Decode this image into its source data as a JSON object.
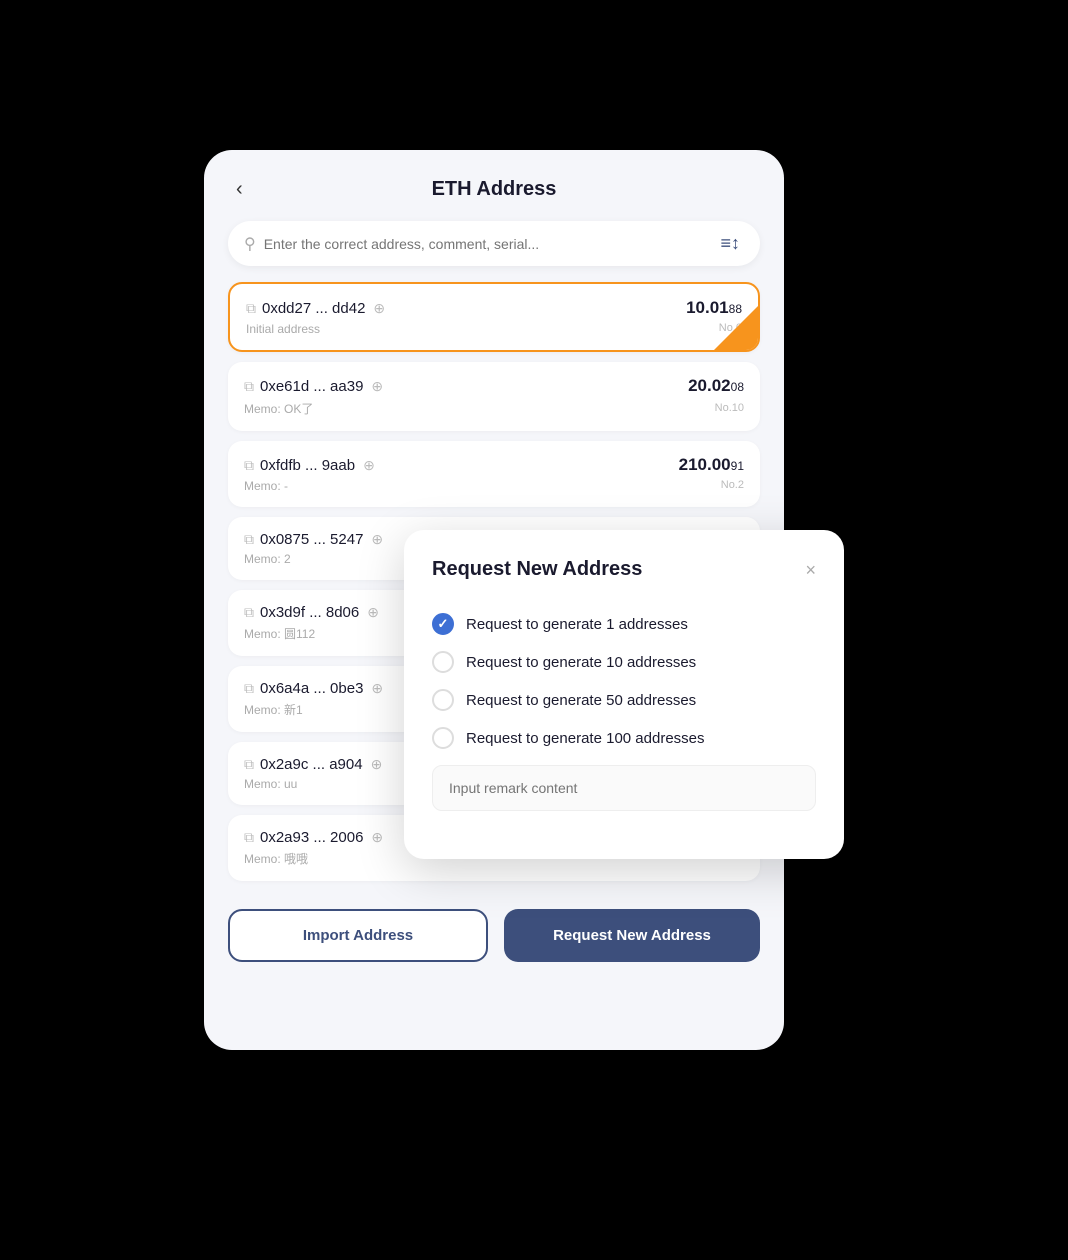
{
  "header": {
    "title": "ETH Address",
    "back_label": "<"
  },
  "search": {
    "placeholder": "Enter the correct address, comment, serial..."
  },
  "addresses": [
    {
      "id": "addr-1",
      "short": "0xdd27 ... dd42",
      "memo": "Initial address",
      "amount_main": "10.01",
      "amount_sub": "88",
      "no": "No.0",
      "highlighted": true
    },
    {
      "id": "addr-2",
      "short": "0xe61d ... aa39",
      "memo": "Memo: OK了",
      "amount_main": "20.02",
      "amount_sub": "08",
      "no": "No.10",
      "highlighted": false
    },
    {
      "id": "addr-3",
      "short": "0xfdfb ... 9aab",
      "memo": "Memo: -",
      "amount_main": "210.00",
      "amount_sub": "91",
      "no": "No.2",
      "highlighted": false
    },
    {
      "id": "addr-4",
      "short": "0x0875 ... 5247",
      "memo": "Memo: 2",
      "amount_main": "",
      "amount_sub": "",
      "no": "",
      "highlighted": false
    },
    {
      "id": "addr-5",
      "short": "0x3d9f ... 8d06",
      "memo": "Memo: 圆112",
      "amount_main": "",
      "amount_sub": "",
      "no": "",
      "highlighted": false
    },
    {
      "id": "addr-6",
      "short": "0x6a4a ... 0be3",
      "memo": "Memo: 新1",
      "amount_main": "",
      "amount_sub": "",
      "no": "",
      "highlighted": false
    },
    {
      "id": "addr-7",
      "short": "0x2a9c ... a904",
      "memo": "Memo: uu",
      "amount_main": "",
      "amount_sub": "",
      "no": "",
      "highlighted": false
    },
    {
      "id": "addr-8",
      "short": "0x2a93 ... 2006",
      "memo": "Memo: 哦哦",
      "amount_main": "",
      "amount_sub": "",
      "no": "",
      "highlighted": false
    }
  ],
  "buttons": {
    "import_label": "Import Address",
    "request_label": "Request New Address"
  },
  "dialog": {
    "title": "Request New Address",
    "close_label": "×",
    "remark_placeholder": "Input remark content",
    "options": [
      {
        "label": "Request to generate 1 addresses",
        "checked": true
      },
      {
        "label": "Request to generate 10 addresses",
        "checked": false
      },
      {
        "label": "Request to generate 50 addresses",
        "checked": false
      },
      {
        "label": "Request to generate 100 addresses",
        "checked": false
      }
    ]
  },
  "icons": {
    "back": "‹",
    "search": "🔍",
    "filter": "≡↕",
    "copy": "⧉",
    "magnify": "⊕"
  }
}
